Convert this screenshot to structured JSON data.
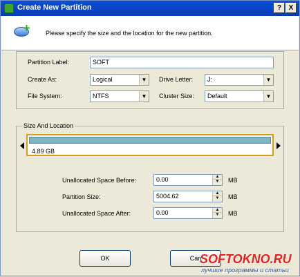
{
  "window": {
    "title": "Create New Partition",
    "help_button": "?",
    "close_button": "X"
  },
  "header": {
    "text": "Please specify the size and the location for the new partition."
  },
  "form": {
    "partition_label": {
      "label": "Partition Label:",
      "value": "SOFT"
    },
    "create_as": {
      "label": "Create As:",
      "value": "Logical"
    },
    "drive_letter": {
      "label": "Drive Letter:",
      "value": "J:"
    },
    "file_system": {
      "label": "File System:",
      "value": "NTFS"
    },
    "cluster_size": {
      "label": "Cluster Size:",
      "value": "Default"
    }
  },
  "size_location": {
    "title": "Size And Location",
    "bar_size_text": "4.89 GB",
    "unallocated_before": {
      "label": "Unallocated Space Before:",
      "value": "0.00",
      "unit": "MB"
    },
    "partition_size": {
      "label": "Partition Size:",
      "value": "5004.62",
      "unit": "MB"
    },
    "unallocated_after": {
      "label": "Unallocated Space After:",
      "value": "0.00",
      "unit": "MB"
    }
  },
  "buttons": {
    "ok": "OK",
    "cancel": "Can"
  },
  "watermark": {
    "main": "SOFTOKNO.RU",
    "sub": "лучшие программы и статьи"
  },
  "icons": {
    "app": "partition-app-icon",
    "header": "new-partition-icon"
  }
}
